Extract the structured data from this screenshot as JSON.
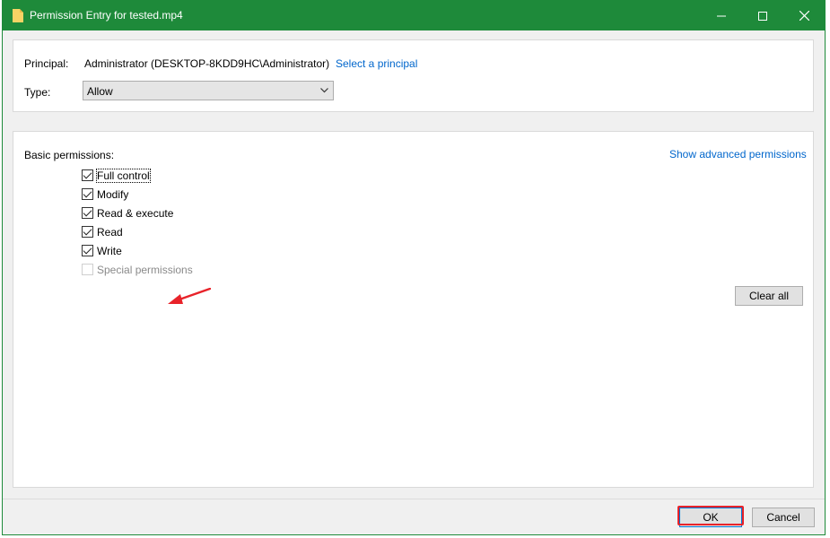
{
  "window": {
    "title": "Permission Entry for tested.mp4",
    "title_icon": "file-icon",
    "controls": [
      "minimize-icon",
      "maximize-icon",
      "close-icon"
    ],
    "accent_color": "#1e8a3a"
  },
  "principal": {
    "label": "Principal:",
    "value": "Administrator (DESKTOP-8KDD9HC\\Administrator)",
    "link": "Select a principal"
  },
  "type": {
    "label": "Type:",
    "selected": "Allow"
  },
  "permissions": {
    "heading": "Basic permissions:",
    "advanced_link": "Show advanced permissions",
    "items": [
      {
        "label": "Full control",
        "checked": true,
        "enabled": true,
        "focused": true
      },
      {
        "label": "Modify",
        "checked": true,
        "enabled": true
      },
      {
        "label": "Read & execute",
        "checked": true,
        "enabled": true
      },
      {
        "label": "Read",
        "checked": true,
        "enabled": true
      },
      {
        "label": "Write",
        "checked": true,
        "enabled": true
      },
      {
        "label": "Special permissions",
        "checked": false,
        "enabled": false
      }
    ],
    "clear_all": "Clear all"
  },
  "footer": {
    "ok": "OK",
    "cancel": "Cancel"
  },
  "annotations": {
    "arrow_color": "#e8232a",
    "highlight_color": "#e8232a"
  }
}
